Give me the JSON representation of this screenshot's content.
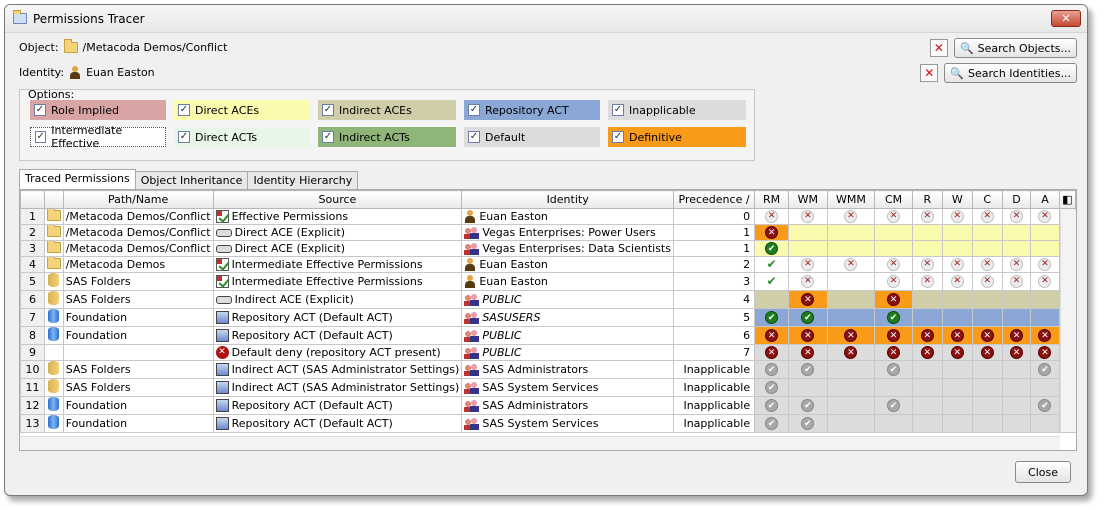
{
  "window": {
    "title": "Permissions Tracer"
  },
  "object": {
    "label": "Object:",
    "value": "/Metacoda Demos/Conflict",
    "search_label": "Search Objects..."
  },
  "identity": {
    "label": "Identity:",
    "value": "Euan Easton",
    "search_label": "Search Identities..."
  },
  "options": {
    "label": "Options:",
    "items": [
      {
        "label": "Role Implied",
        "color": "#d9a4a4"
      },
      {
        "label": "Direct ACEs",
        "color": "#fbfbb0"
      },
      {
        "label": "Indirect ACEs",
        "color": "#cfcea9"
      },
      {
        "label": "Repository ACT",
        "color": "#8aa7d6"
      },
      {
        "label": "Inapplicable",
        "color": "#dcdcdc"
      },
      {
        "label": "Intermediate Effective",
        "color": "#ffffff"
      },
      {
        "label": "Direct ACTs",
        "color": "#e8f6e8"
      },
      {
        "label": "Indirect ACTs",
        "color": "#8fb579"
      },
      {
        "label": "Default",
        "color": "#dcdcdc"
      },
      {
        "label": "Definitive",
        "color": "#f99a18"
      }
    ]
  },
  "tabs": [
    "Traced Permissions",
    "Object Inheritance",
    "Identity Hierarchy"
  ],
  "columns": {
    "path": "Path/Name",
    "source": "Source",
    "identity": "Identity",
    "precedence": "Precedence",
    "perms": [
      "RM",
      "WM",
      "WMM",
      "CM",
      "R",
      "W",
      "C",
      "D",
      "A"
    ]
  },
  "rows": [
    {
      "num": "1",
      "path": "/Metacoda Demos/Conflict",
      "source": "Effective Permissions",
      "identity": "Euan Easton",
      "prec": "0",
      "cells": [
        "xl",
        "xl",
        "xl",
        "xl",
        "xl",
        "xl",
        "xl",
        "xl",
        "xl"
      ]
    },
    {
      "num": "2",
      "path": "/Metacoda Demos/Conflict",
      "source": "Direct ACE (Explicit)",
      "identity": "Vegas Enterprises: Power Users",
      "prec": "1",
      "cells": [
        "xr",
        "",
        "",
        "",
        "",
        "",
        "",
        "",
        ""
      ]
    },
    {
      "num": "3",
      "path": "/Metacoda Demos/Conflict",
      "source": "Direct ACE (Explicit)",
      "identity": "Vegas Enterprises: Data Scientists",
      "prec": "1",
      "cells": [
        "tg",
        "",
        "",
        "",
        "",
        "",
        "",
        "",
        ""
      ]
    },
    {
      "num": "4",
      "path": "/Metacoda Demos",
      "source": "Intermediate Effective Permissions",
      "identity": "Euan Easton",
      "prec": "2",
      "cells": [
        "t",
        "xl",
        "xl",
        "xl",
        "xl",
        "xl",
        "xl",
        "xl",
        "xl"
      ]
    },
    {
      "num": "5",
      "path": "SAS Folders",
      "source": "Intermediate Effective Permissions",
      "identity": "Euan Easton",
      "prec": "3",
      "cells": [
        "t",
        "xl",
        "",
        "xl",
        "xl",
        "xl",
        "xl",
        "xl",
        "xl"
      ]
    },
    {
      "num": "6",
      "path": "SAS Folders",
      "source": "Indirect ACE (Explicit)",
      "identity": "PUBLIC",
      "prec": "4",
      "cells": [
        "",
        "xr",
        "",
        "xr",
        "",
        "",
        "",
        "",
        ""
      ]
    },
    {
      "num": "7",
      "path": "Foundation",
      "source": "Repository ACT (Default ACT)",
      "identity": "SASUSERS",
      "prec": "5",
      "cells": [
        "tg",
        "tg",
        "",
        "tg",
        "",
        "",
        "",
        "",
        ""
      ]
    },
    {
      "num": "8",
      "path": "Foundation",
      "source": "Repository ACT (Default ACT)",
      "identity": "PUBLIC",
      "prec": "6",
      "cells": [
        "xr",
        "xr",
        "xr",
        "xr",
        "xr",
        "xr",
        "xr",
        "xr",
        "xr"
      ]
    },
    {
      "num": "9",
      "path": "",
      "source": "Default deny (repository ACT present)",
      "identity": "PUBLIC",
      "prec": "7",
      "cells": [
        "xr",
        "xr",
        "xr",
        "xr",
        "xr",
        "xr",
        "xr",
        "xr",
        "xr"
      ]
    },
    {
      "num": "10",
      "path": "SAS Folders",
      "source": "Indirect ACT (SAS Administrator Settings)",
      "identity": "SAS Administrators",
      "prec": "Inapplicable",
      "cells": [
        "g",
        "g",
        "",
        "g",
        "",
        "",
        "",
        "",
        "g"
      ]
    },
    {
      "num": "11",
      "path": "SAS Folders",
      "source": "Indirect ACT (SAS Administrator Settings)",
      "identity": "SAS System Services",
      "prec": "Inapplicable",
      "cells": [
        "g",
        "",
        "",
        "",
        "",
        "",
        "",
        "",
        ""
      ]
    },
    {
      "num": "12",
      "path": "Foundation",
      "source": "Repository ACT (Default ACT)",
      "identity": "SAS Administrators",
      "prec": "Inapplicable",
      "cells": [
        "g",
        "g",
        "",
        "g",
        "",
        "",
        "",
        "",
        "g"
      ]
    },
    {
      "num": "13",
      "path": "Foundation",
      "source": "Repository ACT (Default ACT)",
      "identity": "SAS System Services",
      "prec": "Inapplicable",
      "cells": [
        "g",
        "g",
        "",
        "",
        "",
        "",
        "",
        "",
        ""
      ]
    }
  ],
  "close_label": "Close"
}
